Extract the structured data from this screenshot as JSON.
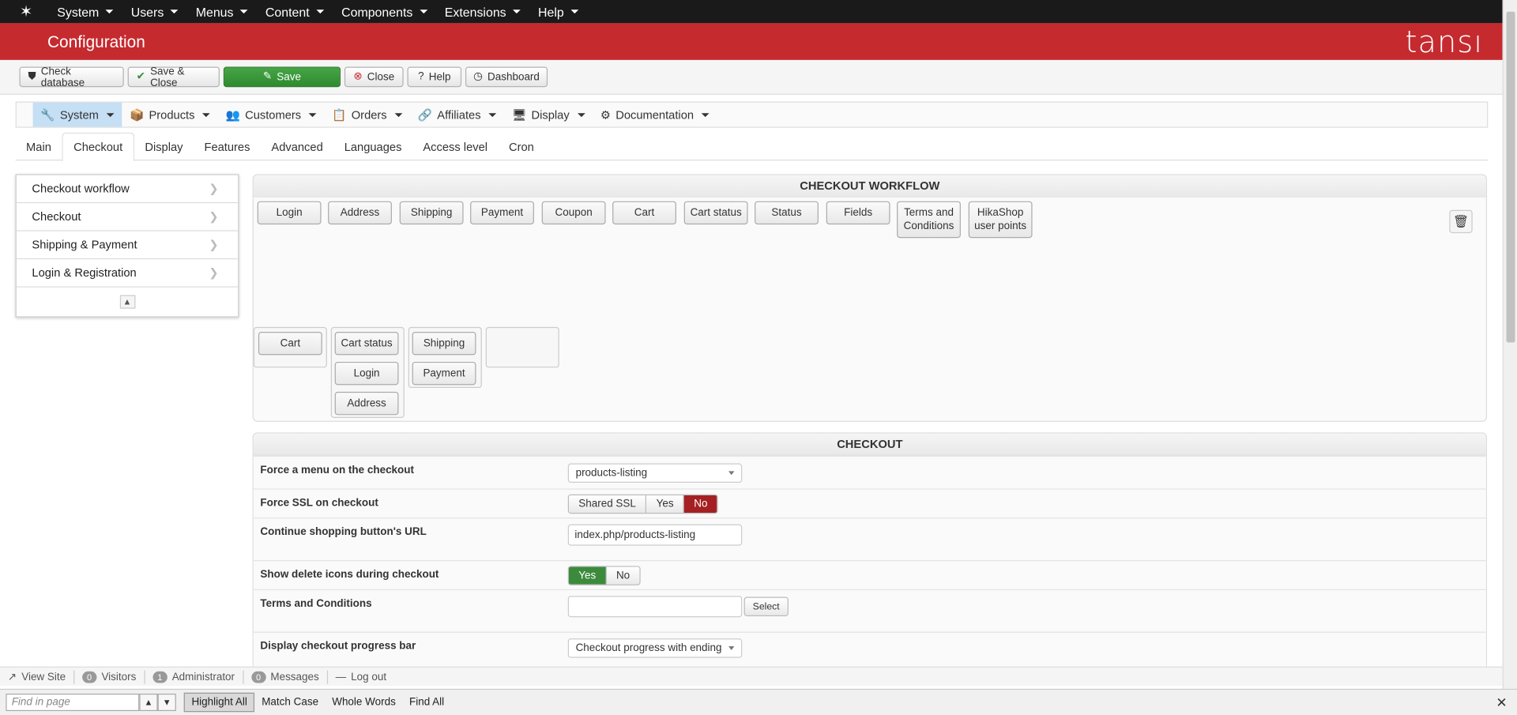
{
  "topnav": {
    "menus": [
      "System",
      "Users",
      "Menus",
      "Content",
      "Components",
      "Extensions",
      "Help"
    ]
  },
  "titlebar": {
    "title": "Configuration",
    "brand": "tansı"
  },
  "toolbar": {
    "check_database": "Check database",
    "save_close": "Save & Close",
    "save": "Save",
    "close": "Close",
    "help": "Help",
    "dashboard": "Dashboard"
  },
  "mainmenu": {
    "items": [
      "System",
      "Products",
      "Customers",
      "Orders",
      "Affiliates",
      "Display",
      "Documentation"
    ]
  },
  "tabs": [
    "Main",
    "Checkout",
    "Display",
    "Features",
    "Advanced",
    "Languages",
    "Access level",
    "Cron"
  ],
  "sidenav": {
    "items": [
      "Checkout workflow",
      "Checkout",
      "Shipping & Payment",
      "Login & Registration"
    ]
  },
  "workflow": {
    "heading": "CHECKOUT WORKFLOW",
    "available": [
      "Login",
      "Address",
      "Shipping",
      "Payment",
      "Coupon",
      "Cart",
      "Cart status",
      "Status",
      "Fields",
      "Terms and Conditions",
      "HikaShop user points"
    ],
    "step1": [
      "Cart"
    ],
    "step2": [
      "Cart status",
      "Login",
      "Address"
    ],
    "step3": [
      "Shipping",
      "Payment"
    ]
  },
  "checkout": {
    "heading": "CHECKOUT",
    "force_menu": {
      "label": "Force a menu on the checkout",
      "value": "products-listing"
    },
    "force_ssl": {
      "label": "Force SSL on checkout",
      "options": [
        "Shared SSL",
        "Yes",
        "No"
      ],
      "selected": "No"
    },
    "continue_url": {
      "label": "Continue shopping button's URL",
      "value": "index.php/products-listing"
    },
    "delete_icons": {
      "label": "Show delete icons during checkout",
      "options": [
        "Yes",
        "No"
      ],
      "selected": "Yes"
    },
    "terms": {
      "label": "Terms and Conditions",
      "value": "",
      "button": "Select"
    },
    "progress_bar": {
      "label": "Display checkout progress bar",
      "value": "Checkout progress with ending"
    }
  },
  "statusbar": {
    "view_site": "View Site",
    "visitors_count": "0",
    "visitors": "Visitors",
    "admin_count": "1",
    "admin": "Administrator",
    "messages_count": "0",
    "messages": "Messages",
    "logout": "Log out"
  },
  "findbar": {
    "placeholder": "Find in page",
    "highlight_all": "Highlight All",
    "match_case": "Match Case",
    "whole_words": "Whole Words",
    "find_all": "Find All"
  },
  "colors": {
    "brand_red": "#c52a2f",
    "save_green": "#3c8a3c",
    "topnav": "#1a1a1a",
    "no_red": "#a52022"
  }
}
